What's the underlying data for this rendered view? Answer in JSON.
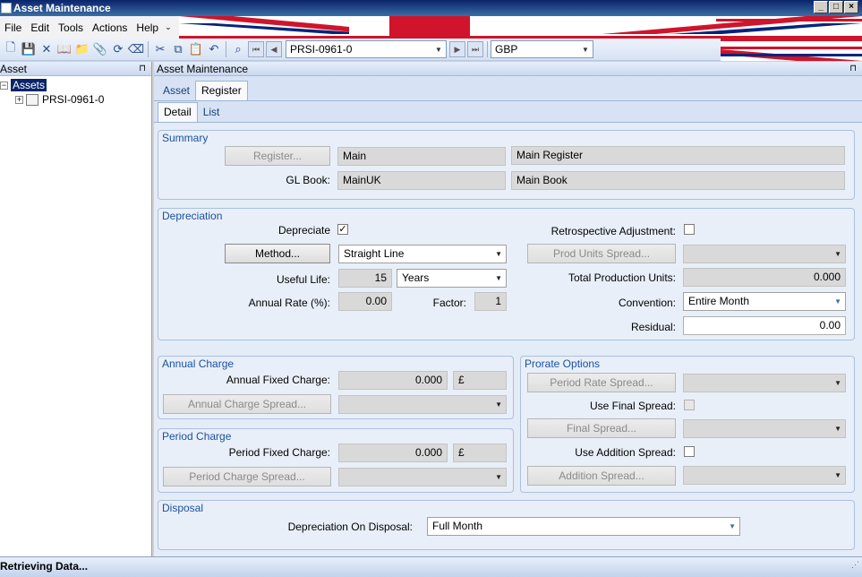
{
  "window": {
    "title": "Asset Maintenance",
    "buttons": [
      "_",
      "□",
      "×"
    ]
  },
  "menu": {
    "items": [
      "File",
      "Edit",
      "Tools",
      "Actions",
      "Help"
    ],
    "more": "⌄"
  },
  "toolbar": {
    "record_combo": "PRSI-0961-0",
    "currency_combo": "GBP"
  },
  "left_pane": {
    "title": "Asset",
    "pin": "⊓",
    "tree": {
      "root_expander": "−",
      "root": "Assets",
      "child_expander": "+",
      "child": "PRSI-0961-0"
    }
  },
  "right_pane": {
    "title": "Asset Maintenance",
    "tabs": [
      "Asset",
      "Register"
    ],
    "subtabs": [
      "Detail",
      "List"
    ]
  },
  "summary": {
    "title": "Summary",
    "register_button": "Register...",
    "register_code": "Main",
    "register_name": "Main Register",
    "gl_book_label": "GL Book:",
    "gl_book_code": "MainUK",
    "gl_book_name": "Main Book"
  },
  "depreciation": {
    "title": "Depreciation",
    "depreciate_label": "Depreciate",
    "depreciate_checked": "✓",
    "method_button": "Method...",
    "method_value": "Straight Line",
    "useful_life_label": "Useful Life:",
    "useful_life_value": "15",
    "useful_life_unit": "Years",
    "annual_rate_label": "Annual Rate (%):",
    "annual_rate_value": "0.00",
    "factor_label": "Factor:",
    "factor_value": "1",
    "retro_label": "Retrospective Adjustment:",
    "prod_units_button": "Prod Units Spread...",
    "total_prod_label": "Total Production Units:",
    "total_prod_value": "0.000",
    "convention_label": "Convention:",
    "convention_value": "Entire Month",
    "residual_label": "Residual:",
    "residual_value": "0.00"
  },
  "annual_charge": {
    "title": "Annual Charge",
    "fixed_label": "Annual Fixed Charge:",
    "fixed_value": "0.000",
    "currency": "£",
    "spread_button": "Annual Charge Spread..."
  },
  "period_charge": {
    "title": "Period Charge",
    "fixed_label": "Period Fixed Charge:",
    "fixed_value": "0.000",
    "currency": "£",
    "spread_button": "Period Charge Spread..."
  },
  "prorate": {
    "title": "Prorate Options",
    "rate_button": "Period Rate Spread...",
    "use_final_label": "Use Final Spread:",
    "final_button": "Final Spread...",
    "use_addition_label": "Use Addition Spread:",
    "addition_button": "Addition Spread..."
  },
  "disposal": {
    "title": "Disposal",
    "label": "Depreciation On Disposal:",
    "value": "Full Month"
  },
  "status": {
    "text": "Retrieving Data..."
  },
  "colors": {
    "title_bar": "#0a246a",
    "group_title": "#1a52a0",
    "selection": "#0a246a"
  }
}
